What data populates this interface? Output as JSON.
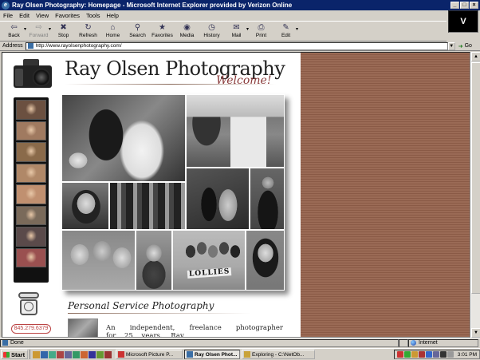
{
  "window": {
    "title": "Ray Olsen Photography: Homepage - Microsoft Internet Explorer provided by Verizon Online",
    "throbber_label": "V"
  },
  "menu": [
    "File",
    "Edit",
    "View",
    "Favorites",
    "Tools",
    "Help"
  ],
  "toolbar": [
    {
      "label": "Back",
      "icon": "back-arrow-icon",
      "glyph": "⇦",
      "enabled": true,
      "dropdown": true
    },
    {
      "label": "Forward",
      "icon": "forward-arrow-icon",
      "glyph": "⇨",
      "enabled": false,
      "dropdown": true
    },
    {
      "label": "Stop",
      "icon": "stop-icon",
      "glyph": "✖",
      "enabled": true
    },
    {
      "label": "Refresh",
      "icon": "refresh-icon",
      "glyph": "↻",
      "enabled": true
    },
    {
      "label": "Home",
      "icon": "home-icon",
      "glyph": "⌂",
      "enabled": true
    },
    {
      "label": "Search",
      "icon": "search-icon",
      "glyph": "⚲",
      "enabled": true
    },
    {
      "label": "Favorites",
      "icon": "favorites-icon",
      "glyph": "★",
      "enabled": true
    },
    {
      "label": "Media",
      "icon": "media-icon",
      "glyph": "◉",
      "enabled": true
    },
    {
      "label": "History",
      "icon": "history-icon",
      "glyph": "◷",
      "enabled": true
    },
    {
      "label": "Mail",
      "icon": "mail-icon",
      "glyph": "✉",
      "enabled": true,
      "dropdown": true
    },
    {
      "label": "Print",
      "icon": "print-icon",
      "glyph": "⎙",
      "enabled": true
    },
    {
      "label": "Edit",
      "icon": "edit-icon",
      "glyph": "✎",
      "enabled": true,
      "dropdown": true
    }
  ],
  "address": {
    "label": "Address",
    "url": "http://www.rayolsenphotography.com/",
    "go_label": "Go"
  },
  "page": {
    "site_title": "Ray Olsen Photography",
    "welcome": "Welcome!",
    "balloon_sign": "LOLLIES",
    "phone_number": "845.279.6379",
    "section_title": "Personal Service Photography",
    "intro_text": "An independent, freelance photographer for 25 years. Ray",
    "film_thumb_colors": [
      "#6b5040",
      "#a07a60",
      "#8a6a4a",
      "#b08868",
      "#c09070",
      "#7a6a5a",
      "#5a4a4a",
      "#9a5050"
    ]
  },
  "status": {
    "text": "Done",
    "zone": "Internet"
  },
  "taskbar": {
    "start_label": "Start",
    "tasks": [
      {
        "label": "Microsoft Picture P...",
        "active": false,
        "icon_color": "#c33"
      },
      {
        "label": "Ray Olsen Phot...",
        "active": true,
        "icon_color": "#3a6ea5"
      },
      {
        "label": "Exploring - C:\\NetOb...",
        "active": false,
        "icon_color": "#c9a33a"
      }
    ],
    "time": "3:01 PM"
  }
}
